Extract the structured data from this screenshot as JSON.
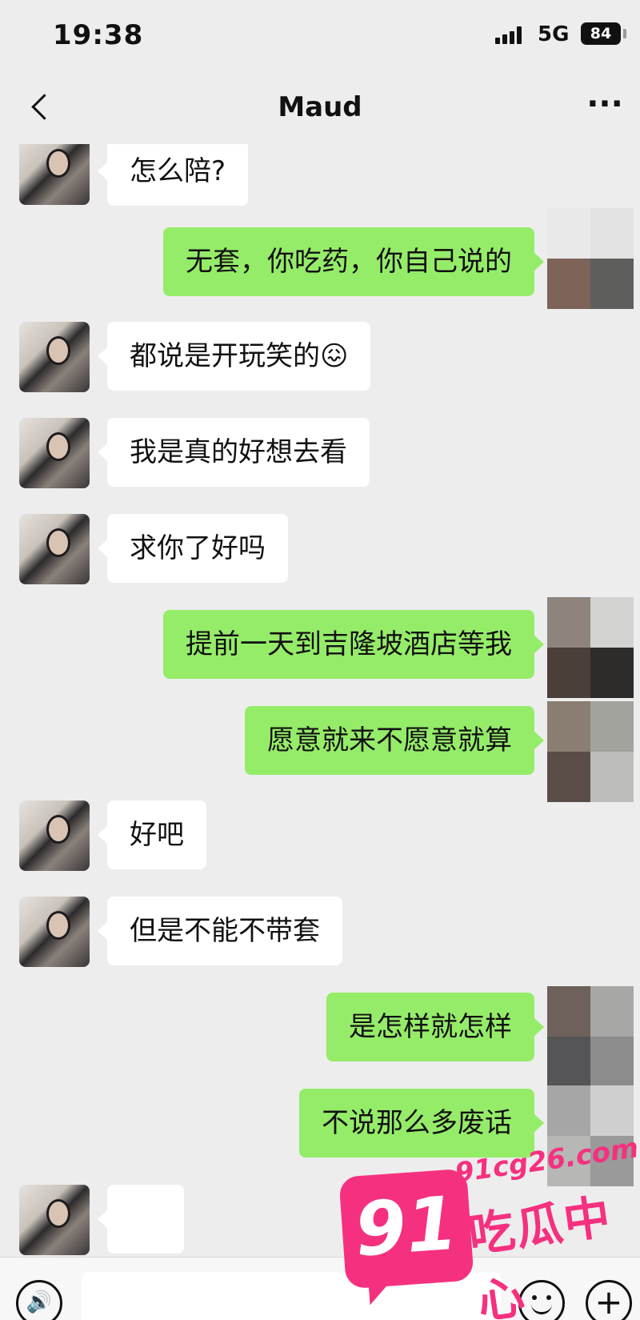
{
  "status_bar": {
    "time": "19:38",
    "network": "5G",
    "battery": "84"
  },
  "header": {
    "title": "Maud",
    "more_label": "···"
  },
  "messages": [
    {
      "side": "in",
      "text": "怎么陪?"
    },
    {
      "side": "out",
      "text": "无套，你吃药，你自己说的"
    },
    {
      "side": "in",
      "text": "都说是开玩笑的😖"
    },
    {
      "side": "in",
      "text": "我是真的好想去看"
    },
    {
      "side": "in",
      "text": "求你了好吗"
    },
    {
      "side": "out",
      "text": "提前一天到吉隆坡酒店等我"
    },
    {
      "side": "out",
      "text": "愿意就来不愿意就算"
    },
    {
      "side": "in",
      "text": "好吧"
    },
    {
      "side": "in",
      "text": "但是不能不带套"
    },
    {
      "side": "out",
      "text": "是怎样就怎样"
    },
    {
      "side": "out",
      "text": "不说那么多废话"
    }
  ],
  "input_bar": {
    "voice_icon": "voice-icon",
    "emoji_icon": "emoji-icon",
    "plus_icon": "plus-icon",
    "plus_label": "+",
    "voice_label": "🔊"
  },
  "watermark": {
    "logo_number": "91",
    "domain": "91cg26.com",
    "brand": "吃瓜中心"
  },
  "colors": {
    "incoming_bubble": "#ffffff",
    "outgoing_bubble": "#95ec69",
    "background": "#ededed",
    "watermark": "#f5317f"
  }
}
